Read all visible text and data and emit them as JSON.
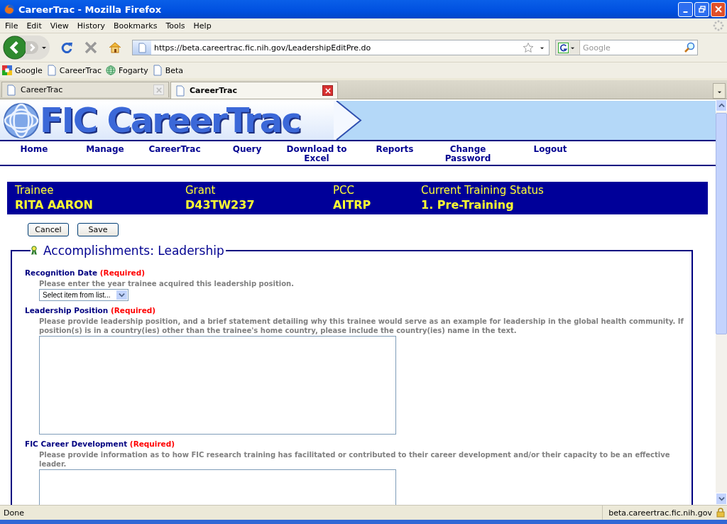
{
  "window": {
    "title": "CareerTrac - Mozilla Firefox"
  },
  "menu_bar": [
    {
      "label": "File"
    },
    {
      "label": "Edit"
    },
    {
      "label": "View"
    },
    {
      "label": "History"
    },
    {
      "label": "Bookmarks"
    },
    {
      "label": "Tools"
    },
    {
      "label": "Help"
    }
  ],
  "toolbar": {
    "url": "https://beta.careertrac.fic.nih.gov/LeadershipEditPre.do",
    "search_placeholder": "Google"
  },
  "bookmarks": [
    {
      "label": "Google",
      "kind": "google"
    },
    {
      "label": "CareerTrac",
      "kind": "page"
    },
    {
      "label": "Fogarty",
      "kind": "globe"
    },
    {
      "label": "Beta",
      "kind": "page"
    }
  ],
  "tabs": [
    {
      "label": "CareerTrac",
      "selected": false
    },
    {
      "label": "CareerTrac",
      "selected": true
    }
  ],
  "page": {
    "logo": "FIC CareerTrac",
    "nav": [
      {
        "label": "Home"
      },
      {
        "label": "Manage"
      },
      {
        "label": "CareerTrac"
      },
      {
        "label": "Query"
      },
      {
        "label": "Download to Excel"
      },
      {
        "label": "Reports"
      },
      {
        "label": "Change Password"
      },
      {
        "label": "Logout"
      }
    ],
    "info": [
      {
        "label": "Trainee",
        "value": "RITA AARON"
      },
      {
        "label": "Grant",
        "value": "D43TW237"
      },
      {
        "label": "PCC",
        "value": "AITRP"
      },
      {
        "label": "Current Training Status",
        "value": "1. Pre-Training"
      }
    ],
    "buttons": [
      "Cancel",
      "Save"
    ],
    "section_title": "Accomplishments: Leadership",
    "fields": [
      {
        "kind": "select",
        "label": "Recognition Date",
        "required": "(Required)",
        "hint": "Please enter the year trainee acquired this leadership position.",
        "value": "Select item from list..."
      },
      {
        "kind": "textarea",
        "label": "Leadership Position",
        "required": "(Required)",
        "hint": "Please provide leadership position, and a brief statement detailing why this trainee would serve as an example for leadership in the global health community. If position(s) is in a country(ies) other than the trainee's home country, please include the country(ies) name in the text."
      },
      {
        "kind": "textarea",
        "label": "FIC Career Development",
        "required": "(Required)",
        "hint": "Please provide information as to how FIC research training has facilitated or contributed to their career development and/or their capacity to be an effective leader."
      }
    ]
  },
  "status_bar": {
    "text": "Done",
    "domain": "beta.careertrac.fic.nih.gov"
  }
}
